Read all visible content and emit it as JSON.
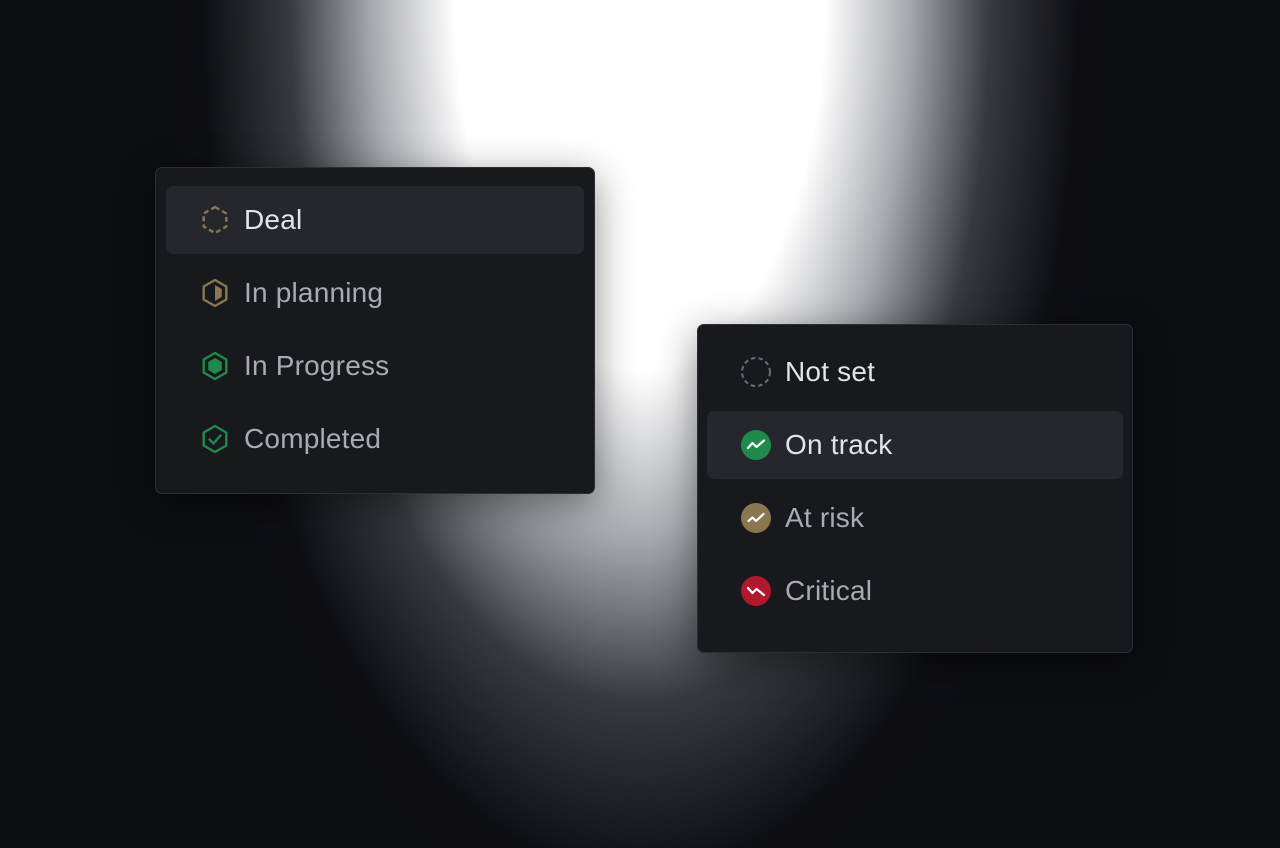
{
  "status_menu": {
    "items": [
      {
        "label": "Deal",
        "icon": "dashed-hexagon-icon",
        "color": "#8a7650",
        "highlighted": true
      },
      {
        "label": "In planning",
        "icon": "half-hexagon-icon",
        "color": "#8a7650"
      },
      {
        "label": "In Progress",
        "icon": "filled-hexagon-icon",
        "color": "#1f8a4c"
      },
      {
        "label": "Completed",
        "icon": "check-hexagon-icon",
        "color": "#1f8a4c"
      }
    ]
  },
  "health_menu": {
    "items": [
      {
        "label": "Not set",
        "icon": "dashed-circle-icon",
        "color": "#6b6d73"
      },
      {
        "label": "On track",
        "icon": "trend-up-circle-icon",
        "color": "#1f8a4c",
        "highlighted": true
      },
      {
        "label": "At risk",
        "icon": "trend-flat-circle-icon",
        "color": "#8a7650"
      },
      {
        "label": "Critical",
        "icon": "trend-down-circle-icon",
        "color": "#b0182e"
      }
    ]
  }
}
